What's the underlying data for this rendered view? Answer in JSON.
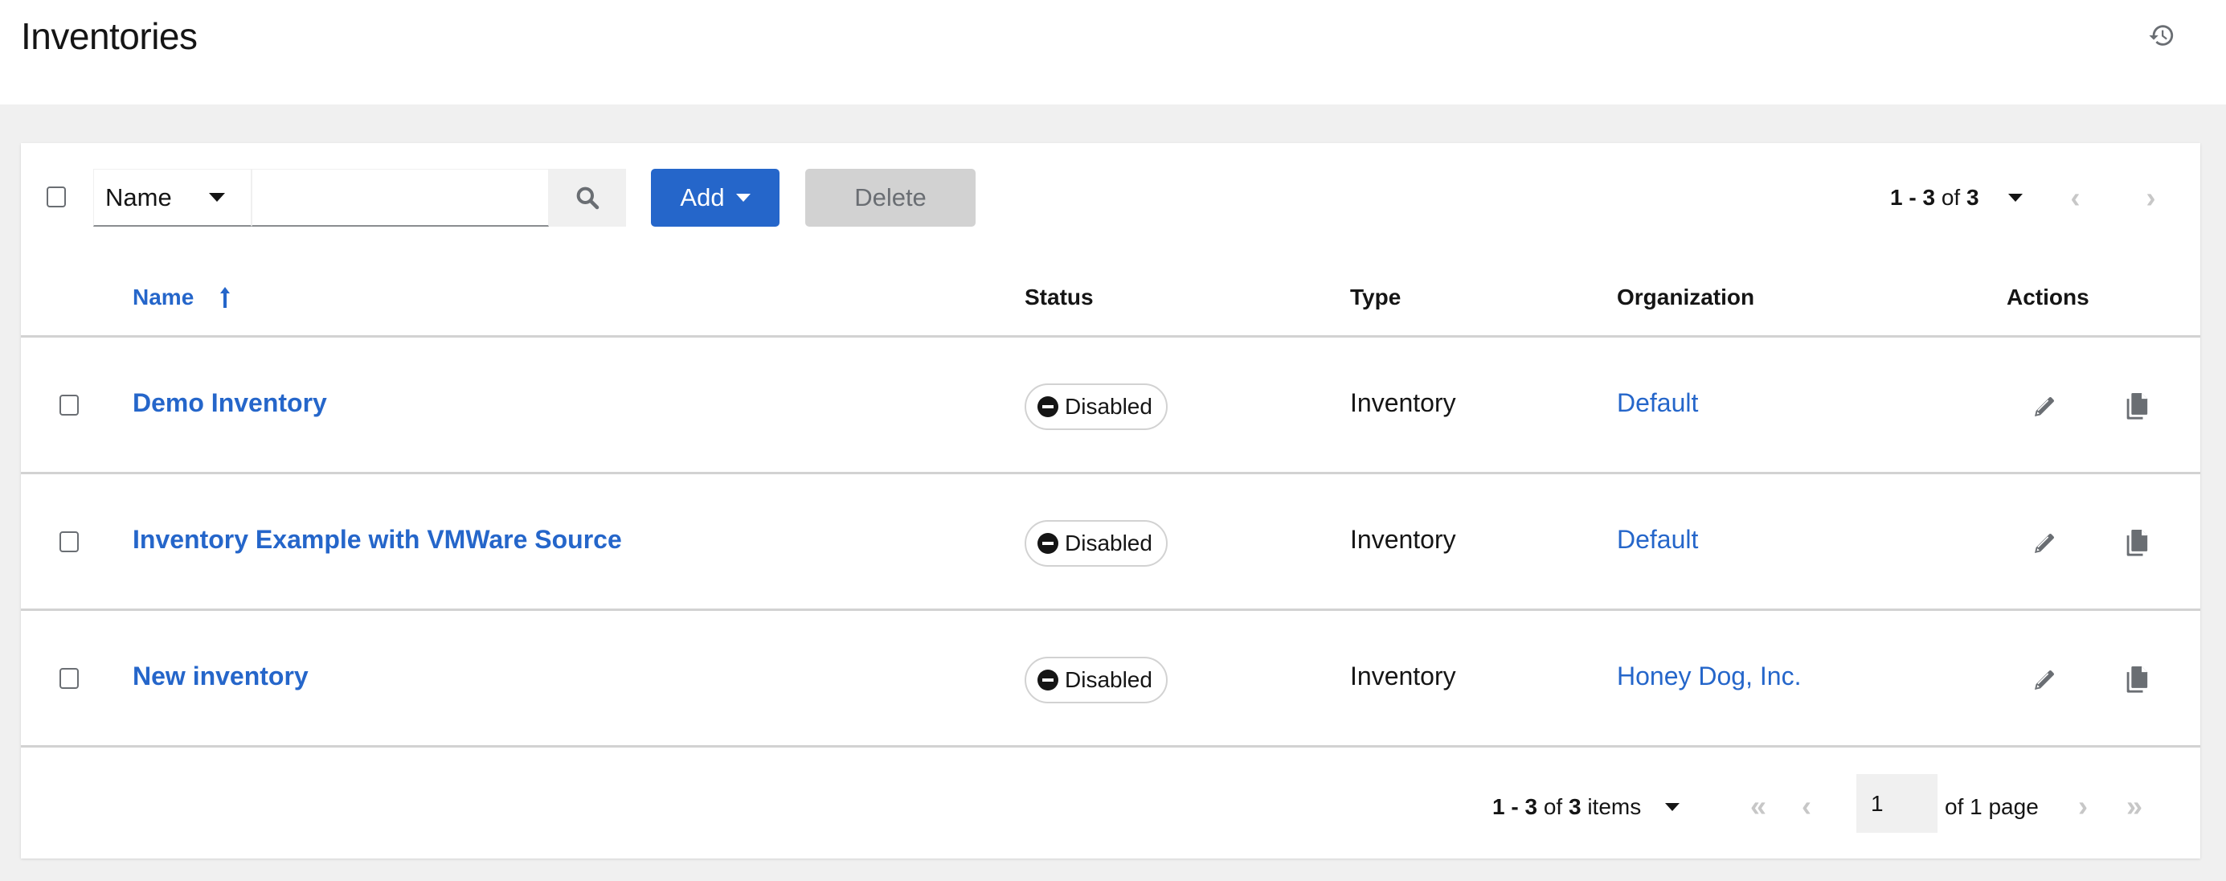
{
  "header": {
    "title": "Inventories",
    "history_icon": "history-icon"
  },
  "toolbar": {
    "select_all_checked": false,
    "filter_field": "Name",
    "search_value": "",
    "search_placeholder": "",
    "search_icon": "search-icon",
    "add_label": "Add",
    "delete_label": "Delete",
    "pagination": {
      "range_start": "1",
      "range_sep": " - ",
      "range_end": "3",
      "of_word": " of ",
      "total": "3"
    }
  },
  "table": {
    "columns": {
      "name": "Name",
      "status": "Status",
      "type": "Type",
      "organization": "Organization",
      "actions": "Actions"
    },
    "sort": {
      "column": "name",
      "direction": "ascending"
    },
    "rows": [
      {
        "name": "Demo Inventory",
        "status": "Disabled",
        "type": "Inventory",
        "organization": "Default"
      },
      {
        "name": "Inventory Example with VMWare Source",
        "status": "Disabled",
        "type": "Inventory",
        "organization": "Default"
      },
      {
        "name": "New inventory",
        "status": "Disabled",
        "type": "Inventory",
        "organization": "Honey Dog, Inc."
      }
    ]
  },
  "footer": {
    "range_start": "1",
    "range_sep": " - ",
    "range_end": "3",
    "of_word": " of ",
    "total": "3",
    "items_word": " items",
    "current_page": "1",
    "of_pages": "of 1 page"
  },
  "colors": {
    "primary": "#2566ca",
    "disabled_button": "#d2d2d2",
    "page_background": "#f0f0f0",
    "text": "#151515",
    "icon": "#6a6e73"
  }
}
